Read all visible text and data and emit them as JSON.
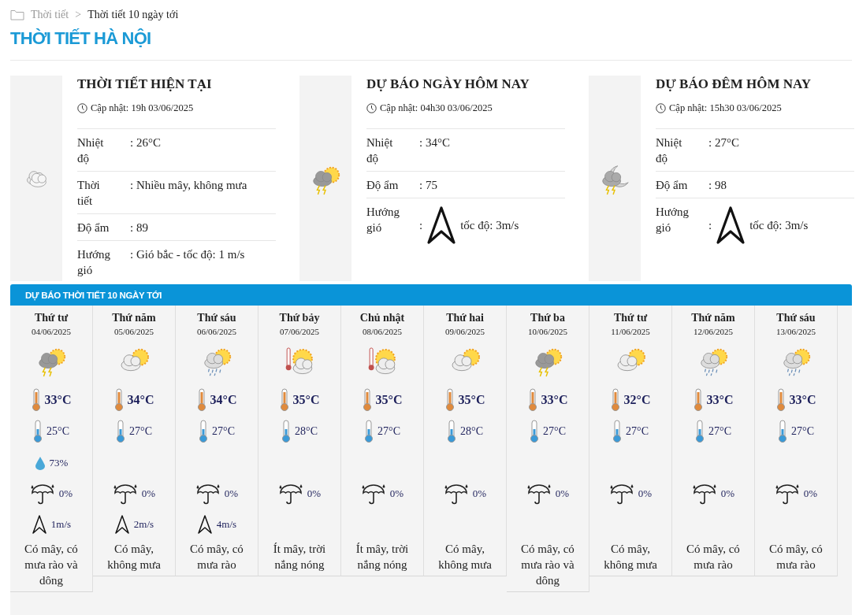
{
  "breadcrumb": {
    "home": "Thời tiết",
    "separator": ">",
    "current": "Thời tiết 10 ngày tới"
  },
  "title": "THỜI TIẾT HÀ NỘI",
  "panels": [
    {
      "kind": "cloudy",
      "title": "THỜI TIẾT HIỆN TẠI",
      "updated": "Cập nhật: 19h 03/06/2025",
      "rows": [
        {
          "kind": "text",
          "label": "Nhiệt độ",
          "value": ": 26°C"
        },
        {
          "kind": "text",
          "label": "Thời tiết",
          "value": ": Nhiều mây, không mưa"
        },
        {
          "kind": "text",
          "label": "Độ ẩm",
          "value": ": 89"
        },
        {
          "kind": "text",
          "label": "Hướng gió",
          "value": ": Gió bắc - tốc độ: 1 m/s"
        }
      ]
    },
    {
      "kind": "storm-sun",
      "title": "DỰ BÁO NGÀY HÔM NAY",
      "updated": "Cập nhật: 04h30 03/06/2025",
      "rows": [
        {
          "kind": "text",
          "label": "Nhiệt độ",
          "value": ": 34°C"
        },
        {
          "kind": "text",
          "label": "Độ ẩm",
          "value": ": 75"
        },
        {
          "kind": "wind",
          "label": "Hướng gió",
          "colon": ":",
          "value": "tốc độ: 3m/s"
        }
      ]
    },
    {
      "kind": "storm-moon",
      "title": "DỰ BÁO ĐÊM HÔM NAY",
      "updated": "Cập nhật: 15h30 03/06/2025",
      "rows": [
        {
          "kind": "text",
          "label": "Nhiệt độ",
          "value": ": 27°C"
        },
        {
          "kind": "text",
          "label": "Độ ẩm",
          "value": ": 98"
        },
        {
          "kind": "wind",
          "label": "Hướng gió",
          "colon": ":",
          "value": "tốc độ: 3m/s"
        }
      ]
    }
  ],
  "forecast": {
    "title": "DỰ BÁO THỜI TIẾT 10 NGÀY TỚI",
    "days": [
      {
        "day": "Thứ tư",
        "date": "04/06/2025",
        "kind": "storm-sun",
        "max": "33°C",
        "min": "25°C",
        "humidity": "73%",
        "rain": "0%",
        "wind": "1m/s",
        "desc": "Có mây, có mưa rào và dông"
      },
      {
        "day": "Thứ năm",
        "date": "05/06/2025",
        "kind": "sun-cloud",
        "max": "34°C",
        "min": "27°C",
        "rain": "0%",
        "wind": "2m/s",
        "desc": "Có mây, không mưa"
      },
      {
        "day": "Thứ sáu",
        "date": "06/06/2025",
        "kind": "rain-sun",
        "max": "34°C",
        "min": "27°C",
        "rain": "0%",
        "wind": "4m/s",
        "desc": "Có mây, có mưa rào"
      },
      {
        "day": "Thứ bảy",
        "date": "07/06/2025",
        "kind": "hot",
        "max": "35°C",
        "min": "28°C",
        "rain": "0%",
        "desc": "Ít mây, trời nắng nóng"
      },
      {
        "day": "Chủ nhật",
        "date": "08/06/2025",
        "kind": "hot",
        "max": "35°C",
        "min": "27°C",
        "rain": "0%",
        "desc": "Ít mây, trời nắng nóng"
      },
      {
        "day": "Thứ hai",
        "date": "09/06/2025",
        "kind": "sun-cloud",
        "max": "35°C",
        "min": "28°C",
        "rain": "0%",
        "desc": "Có mây, không mưa"
      },
      {
        "day": "Thứ ba",
        "date": "10/06/2025",
        "kind": "storm-sun",
        "max": "33°C",
        "min": "27°C",
        "rain": "0%",
        "desc": "Có mây, có mưa rào và dông"
      },
      {
        "day": "Thứ tư",
        "date": "11/06/2025",
        "kind": "sun-cloud",
        "max": "32°C",
        "min": "27°C",
        "rain": "0%",
        "desc": "Có mây, không mưa"
      },
      {
        "day": "Thứ năm",
        "date": "12/06/2025",
        "kind": "rain-sun",
        "max": "33°C",
        "min": "27°C",
        "rain": "0%",
        "desc": "Có mây, có mưa rào"
      },
      {
        "day": "Thứ sáu",
        "date": "13/06/2025",
        "kind": "rain-sun",
        "max": "33°C",
        "min": "27°C",
        "rain": "0%",
        "desc": "Có mây, có mưa rào"
      }
    ]
  }
}
